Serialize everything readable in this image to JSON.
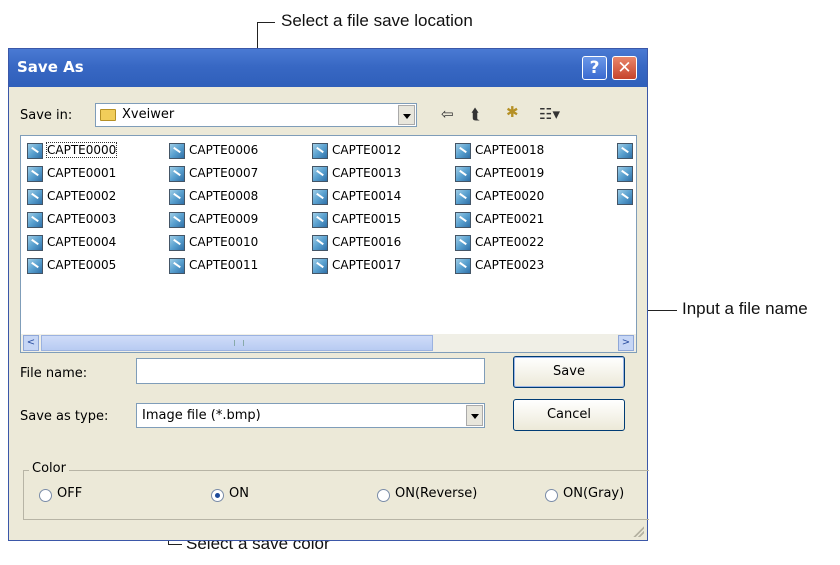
{
  "annotations": {
    "save_location": "Select a file save location",
    "file_name": "Input a file name",
    "save_color": "Select a save color"
  },
  "dialog": {
    "title": "Save As",
    "help_glyph": "?",
    "close_glyph": "✕",
    "save_in_label": "Save in:",
    "save_in_value": "Xveiwer",
    "toolbar": {
      "back_glyph": "⇦",
      "up_glyph": "⮬",
      "newfolder_glyph": "✱",
      "views_glyph": "☷▾"
    },
    "files": [
      "CAPTE0000",
      "CAPTE0001",
      "CAPTE0002",
      "CAPTE0003",
      "CAPTE0004",
      "CAPTE0005",
      "CAPTE0006",
      "CAPTE0007",
      "CAPTE0008",
      "CAPTE0009",
      "CAPTE0010",
      "CAPTE0011",
      "CAPTE0012",
      "CAPTE0013",
      "CAPTE0014",
      "CAPTE0015",
      "CAPTE0016",
      "CAPTE0017",
      "CAPTE0018",
      "CAPTE0019",
      "CAPTE0020",
      "CAPTE0021",
      "CAPTE0022",
      "CAPTE0023"
    ],
    "scroll_left": "<",
    "scroll_right": ">",
    "file_name_label": "File name:",
    "file_name_value": "",
    "save_type_label": "Save as type:",
    "save_type_value": "Image file (*.bmp)",
    "save_button": "Save",
    "cancel_button": "Cancel",
    "color_group": {
      "legend": "Color",
      "options": [
        "OFF",
        "ON",
        "ON(Reverse)",
        "ON(Gray)"
      ],
      "selected": "ON"
    }
  }
}
